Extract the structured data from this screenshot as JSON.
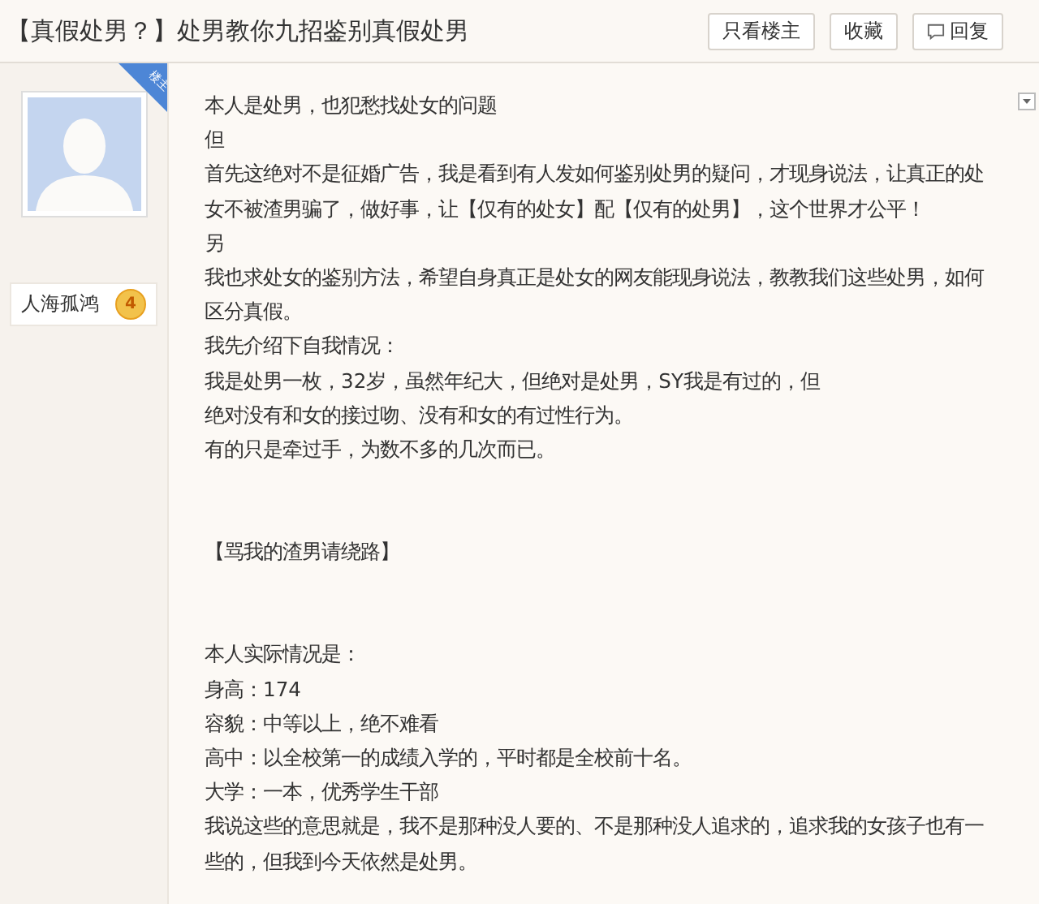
{
  "title": "【真假处男？】处男教你九招鉴别真假处男",
  "actions": [
    {
      "label": "只看楼主",
      "kind": "text"
    },
    {
      "label": "收藏",
      "kind": "text"
    },
    {
      "label": "回复",
      "kind": "reply"
    }
  ],
  "author": {
    "badge": "楼主",
    "rank_title": "人海孤鸿",
    "level": "4"
  },
  "sections": [
    [
      "本人是处男，也犯愁找处女的问题",
      "但",
      "首先这绝对不是征婚广告，我是看到有人发如何鉴别处男的疑问，才现身说法，让真正的处",
      "女不被渣男骗了，做好事，让【仅有的处女】配【仅有的处男】，这个世界才公平！",
      "另",
      "我也求处女的鉴别方法，希望自身真正是处女的网友能现身说法，教教我们这些处男，如何",
      "区分真假。",
      "我先介绍下自我情况：",
      "我是处男一枚，32岁，虽然年纪大，但绝对是处男，SY我是有过的，但",
      "绝对没有和女的接过吻、没有和女的有过性行为。",
      "有的只是牵过手，为数不多的几次而已。"
    ],
    [
      "【骂我的渣男请绕路】"
    ],
    [
      "本人实际情况是：",
      "身高：174",
      "容貌：中等以上，绝不难看",
      "高中：以全校第一的成绩入学的，平时都是全校前十名。",
      "大学：一本，优秀学生干部",
      "我说这些的意思就是，我不是那种没人要的、不是那种没人追求的，追求我的女孩子也有一",
      "些的，但我到今天依然是处男。"
    ]
  ]
}
